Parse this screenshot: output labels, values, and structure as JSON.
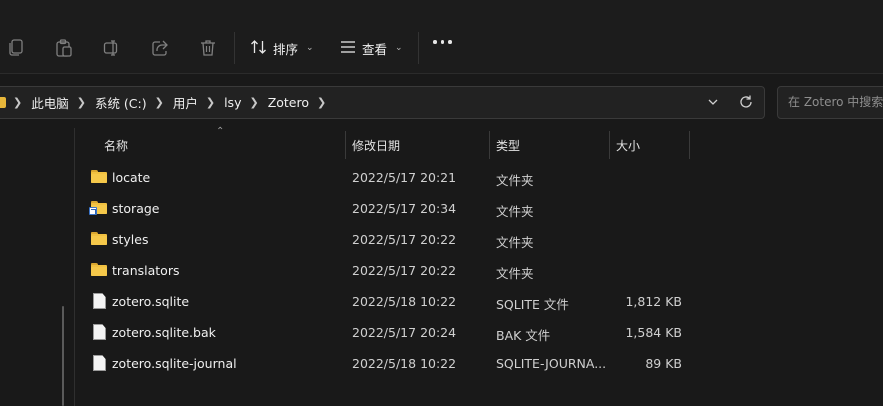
{
  "toolbar": {
    "sort_label": "排序",
    "view_label": "查看",
    "icons": [
      "copy-icon",
      "paste-icon",
      "rename-icon",
      "share-icon",
      "delete-icon",
      "sort-icon",
      "view-icon",
      "more-icon"
    ]
  },
  "address": {
    "crumbs": [
      "此电脑",
      "系统 (C:)",
      "用户",
      "lsy",
      "Zotero"
    ],
    "search_placeholder": "在 Zotero 中搜索"
  },
  "columns": {
    "name": "名称",
    "date": "修改日期",
    "type": "类型",
    "size": "大小"
  },
  "files": [
    {
      "name": "locate",
      "date": "2022/5/17 20:21",
      "type": "文件夹",
      "size": "",
      "kind": "folder"
    },
    {
      "name": "storage",
      "date": "2022/5/17 20:34",
      "type": "文件夹",
      "size": "",
      "kind": "folder-shortcut"
    },
    {
      "name": "styles",
      "date": "2022/5/17 20:22",
      "type": "文件夹",
      "size": "",
      "kind": "folder"
    },
    {
      "name": "translators",
      "date": "2022/5/17 20:22",
      "type": "文件夹",
      "size": "",
      "kind": "folder"
    },
    {
      "name": "zotero.sqlite",
      "date": "2022/5/18 10:22",
      "type": "SQLITE 文件",
      "size": "1,812 KB",
      "kind": "file"
    },
    {
      "name": "zotero.sqlite.bak",
      "date": "2022/5/17 20:24",
      "type": "BAK 文件",
      "size": "1,584 KB",
      "kind": "file"
    },
    {
      "name": "zotero.sqlite-journal",
      "date": "2022/5/18 10:22",
      "type": "SQLITE-JOURNA...",
      "size": "89 KB",
      "kind": "file"
    }
  ]
}
